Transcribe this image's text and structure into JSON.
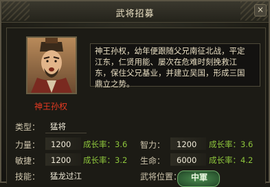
{
  "window": {
    "title": "武将招募",
    "close_symbol": "×"
  },
  "general": {
    "name": "神王孙权",
    "bio_lines": [
      "神王孙权，幼年便跟随父兄南征北战，平定",
      "江东，仁贤用能、屡次在危难时刻挽救江",
      "东，保住父兄基业，并建立吴国，形成三国",
      "鼎立之势。"
    ],
    "type_label": "类型：",
    "type_value": "猛将",
    "stats": {
      "strength": {
        "label": "力量：",
        "value": "1200",
        "growth": "成长率：3.6"
      },
      "intelligence": {
        "label": "智力：",
        "value": "1200",
        "growth": "成长率：3.6"
      },
      "agility": {
        "label": "敏捷：",
        "value": "1200",
        "growth": "成长率：3.2"
      },
      "life": {
        "label": "生命：",
        "value": "6000",
        "growth": "成长率：4.2"
      }
    },
    "skill_label": "技能：",
    "skill_value": "猛龙过江",
    "position_label": "武将位置：",
    "position_value": "中軍"
  }
}
